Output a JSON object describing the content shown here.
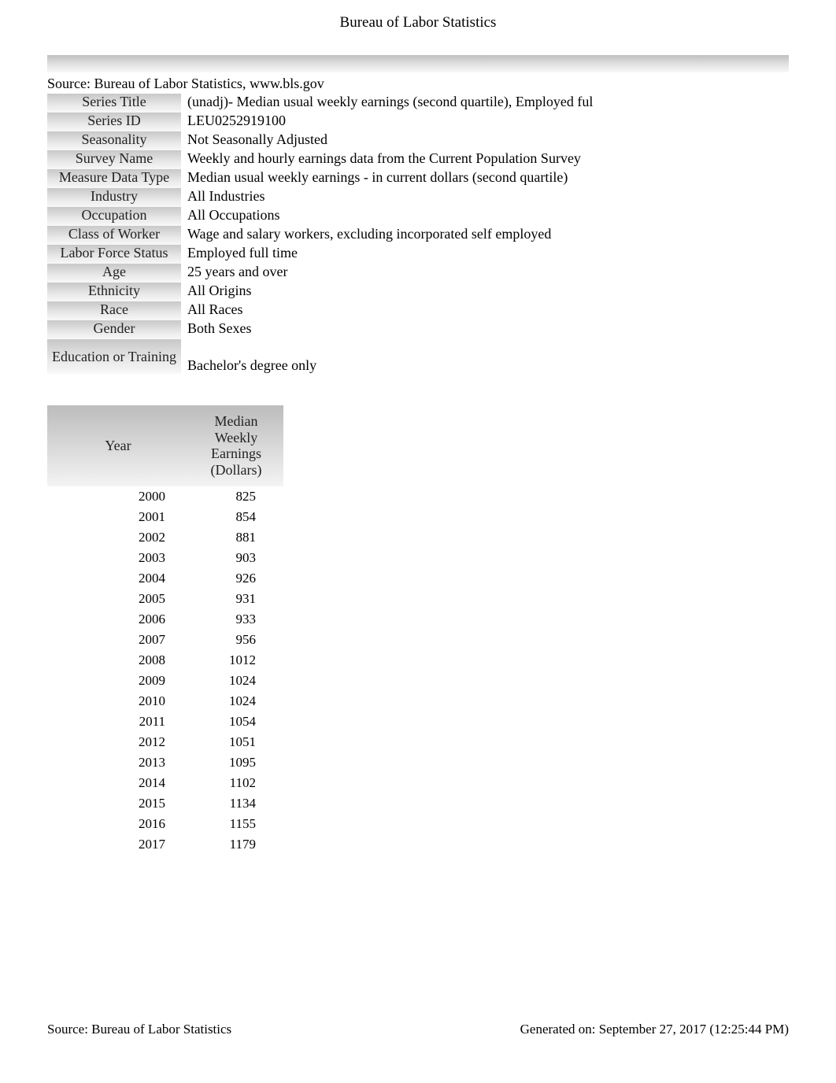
{
  "title": "Bureau of Labor Statistics",
  "source": "Source: Bureau of Labor Statistics, www.bls.gov",
  "metadata": [
    {
      "label": "Series Title",
      "value": "(unadj)- Median usual weekly earnings (second quartile), Employed ful"
    },
    {
      "label": "Series ID",
      "value": "LEU0252919100"
    },
    {
      "label": "Seasonality",
      "value": "Not Seasonally Adjusted"
    },
    {
      "label": "Survey Name",
      "value": "Weekly and hourly earnings data from the Current Population Survey"
    },
    {
      "label": "Measure Data Type",
      "value": "Median usual weekly earnings - in current dollars (second quartile)"
    },
    {
      "label": "Industry",
      "value": "All Industries"
    },
    {
      "label": "Occupation",
      "value": "All Occupations"
    },
    {
      "label": "Class of Worker",
      "value": "Wage and salary workers, excluding incorporated self employed"
    },
    {
      "label": "Labor Force Status",
      "value": "Employed full time"
    },
    {
      "label": "Age",
      "value": "25 years and over"
    },
    {
      "label": "Ethnicity",
      "value": "All Origins"
    },
    {
      "label": "Race",
      "value": "All Races"
    },
    {
      "label": "Gender",
      "value": "Both Sexes"
    },
    {
      "label": "Education or Training",
      "value": "Bachelor's degree only",
      "tall": true
    }
  ],
  "columns": {
    "year": "Year",
    "earnings": "Median\nWeekly\nEarnings\n(Dollars)"
  },
  "chart_data": {
    "type": "table",
    "title": "Median Weekly Earnings (Dollars) by Year",
    "columns": [
      "Year",
      "Median Weekly Earnings (Dollars)"
    ],
    "rows": [
      {
        "year": 2000,
        "earnings": 825
      },
      {
        "year": 2001,
        "earnings": 854
      },
      {
        "year": 2002,
        "earnings": 881
      },
      {
        "year": 2003,
        "earnings": 903
      },
      {
        "year": 2004,
        "earnings": 926
      },
      {
        "year": 2005,
        "earnings": 931
      },
      {
        "year": 2006,
        "earnings": 933
      },
      {
        "year": 2007,
        "earnings": 956
      },
      {
        "year": 2008,
        "earnings": 1012
      },
      {
        "year": 2009,
        "earnings": 1024
      },
      {
        "year": 2010,
        "earnings": 1024
      },
      {
        "year": 2011,
        "earnings": 1054
      },
      {
        "year": 2012,
        "earnings": 1051
      },
      {
        "year": 2013,
        "earnings": 1095
      },
      {
        "year": 2014,
        "earnings": 1102
      },
      {
        "year": 2015,
        "earnings": 1134
      },
      {
        "year": 2016,
        "earnings": 1155
      },
      {
        "year": 2017,
        "earnings": 1179
      }
    ]
  },
  "footer": {
    "left": "Source: Bureau of Labor Statistics",
    "right": "Generated on: September 27, 2017 (12:25:44 PM)"
  }
}
